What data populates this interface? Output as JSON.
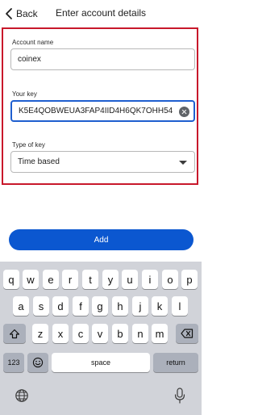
{
  "header": {
    "back_label": "Back",
    "title": "Enter account details"
  },
  "form": {
    "account_name_label": "Account name",
    "account_name_value": "coinex",
    "your_key_label": "Your key",
    "your_key_value": "K5E4QOBWEUA3FAP4IID4H6QK7OHH54",
    "type_label": "Type of key",
    "type_value": "Time based"
  },
  "add_label": "Add",
  "keyboard": {
    "row1": [
      "q",
      "w",
      "e",
      "r",
      "t",
      "y",
      "u",
      "i",
      "o",
      "p"
    ],
    "row2": [
      "a",
      "s",
      "d",
      "f",
      "g",
      "h",
      "j",
      "k",
      "l"
    ],
    "row3": [
      "z",
      "x",
      "c",
      "v",
      "b",
      "n",
      "m"
    ],
    "numbers_label": "123",
    "space_label": "space",
    "return_label": "return"
  },
  "colors": {
    "accent": "#0b57d0",
    "highlight_border": "#c8182b",
    "focus_border": "#1f5fcf",
    "keyboard_bg": "#d1d3d9"
  }
}
